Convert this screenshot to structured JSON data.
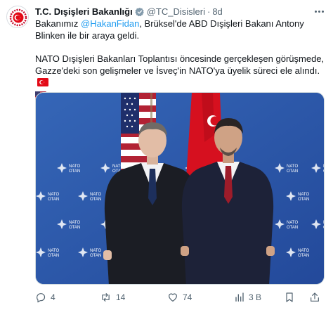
{
  "tweet": {
    "author_name": "T.C. Dışişleri Bakanlığı",
    "handle": "@TC_Disisleri",
    "separator": "·",
    "time": "8d",
    "text": {
      "line1_prefix": "Bakanımız ",
      "mention": "@HakanFidan",
      "line1_suffix": ", Brüksel'de ABD Dışişleri Bakanı Antony Blinken ile bir araya geldi.",
      "paragraph2": "NATO Dışişleri Bakanları Toplantısı öncesinde gerçekleşen görüşmede, Gazze'deki son gelişmeler ve İsveç'in NATO'ya üyelik süreci ele alındı."
    },
    "media": {
      "backdrop_logo_text": "NATO",
      "backdrop_logo_subtext": "OTAN"
    },
    "actions": {
      "replies": "4",
      "reposts": "14",
      "likes": "74",
      "views": "3 B"
    }
  },
  "colors": {
    "verified_badge": "#829aab",
    "mention": "#1d9bf0",
    "backdrop": "#2c58a8"
  },
  "icons": [
    "more-icon",
    "verified-badge-icon",
    "turkey-flag-icon",
    "us-flag-icon",
    "reply-icon",
    "repost-icon",
    "like-icon",
    "views-icon",
    "bookmark-icon",
    "share-icon"
  ]
}
